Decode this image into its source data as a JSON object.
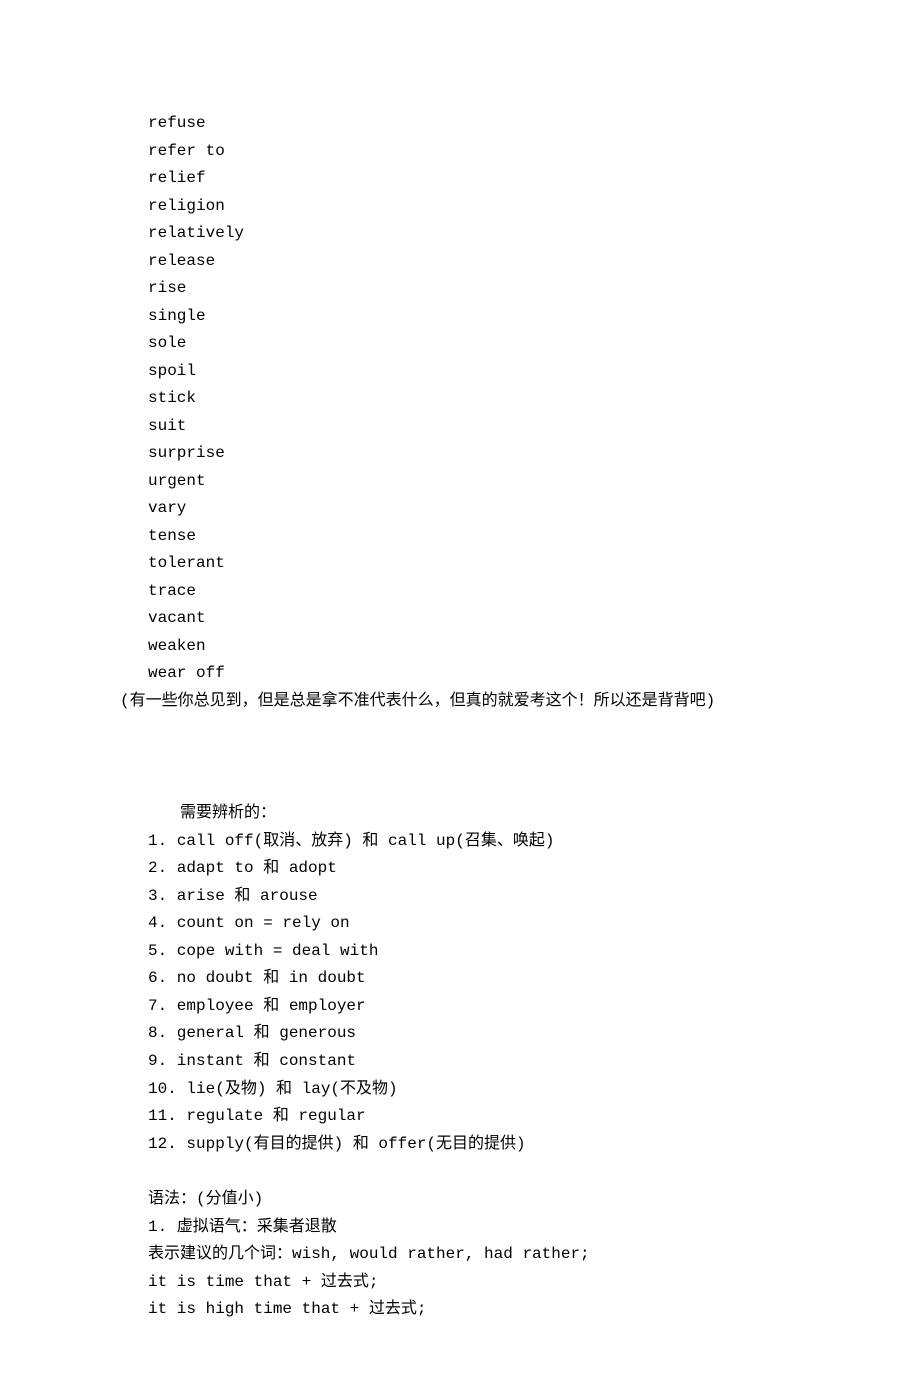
{
  "words": [
    "refuse",
    "refer to",
    "relief",
    "religion",
    "relatively",
    "release",
    "rise",
    "single",
    "sole",
    "spoil",
    "stick",
    "suit",
    "surprise",
    "urgent",
    "vary",
    "tense",
    "tolerant",
    "trace",
    "vacant",
    "weaken",
    "wear off"
  ],
  "note": "(有一些你总见到，但是总是拿不准代表什么，但真的就爱考这个！所以还是背背吧)",
  "comparison": {
    "heading": "需要辨析的：",
    "items": [
      "1. call off(取消、放弃) 和 call up(召集、唤起)",
      "2. adapt to 和 adopt",
      "3. arise 和 arouse",
      "4. count on = rely on",
      "5. cope with = deal with",
      "6. no doubt 和 in doubt",
      "7. employee 和 employer",
      "8. general 和 generous",
      "9. instant 和 constant",
      "10. lie(及物) 和 lay(不及物)",
      "11. regulate 和 regular",
      "12. supply(有目的提供) 和 offer(无目的提供)"
    ]
  },
  "grammar": {
    "heading": "语法：(分值小)",
    "lines": [
      "1. 虚拟语气：采集者退散",
      "表示建议的几个词：wish, would rather, had rather;",
      "it is time that + 过去式;",
      "it is high time that + 过去式;"
    ]
  }
}
